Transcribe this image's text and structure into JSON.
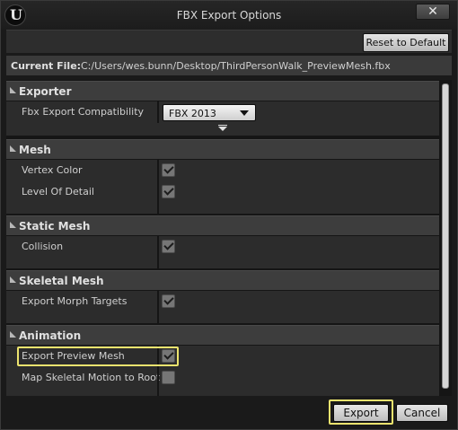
{
  "window": {
    "title": "FBX Export Options",
    "close_glyph": "✕",
    "logo_glyph": "U"
  },
  "toolbar": {
    "reset_label": "Reset to Default"
  },
  "file": {
    "label": "Current File:",
    "path": "C:/Users/wes.bunn/Desktop/ThirdPersonWalk_PreviewMesh.fbx"
  },
  "categories": {
    "exporter": {
      "label": "Exporter",
      "rows": [
        {
          "label": "Fbx Export Compatibility",
          "value": "FBX 2013"
        }
      ]
    },
    "mesh": {
      "label": "Mesh",
      "rows": [
        {
          "label": "Vertex Color",
          "checked": true
        },
        {
          "label": "Level Of Detail",
          "checked": true
        }
      ]
    },
    "static_mesh": {
      "label": "Static Mesh",
      "rows": [
        {
          "label": "Collision",
          "checked": true
        }
      ]
    },
    "skeletal_mesh": {
      "label": "Skeletal Mesh",
      "rows": [
        {
          "label": "Export Morph Targets",
          "checked": true
        }
      ]
    },
    "animation": {
      "label": "Animation",
      "rows": [
        {
          "label": "Export Preview Mesh",
          "checked": true
        },
        {
          "label": "Map Skeletal Motion to Root",
          "checked": false
        }
      ]
    }
  },
  "footer": {
    "export_label": "Export",
    "cancel_label": "Cancel"
  },
  "colors": {
    "highlight": "#ece36e",
    "background": "#1a1a1a",
    "category": "#3d3d3d",
    "row": "#2c2c2c"
  }
}
